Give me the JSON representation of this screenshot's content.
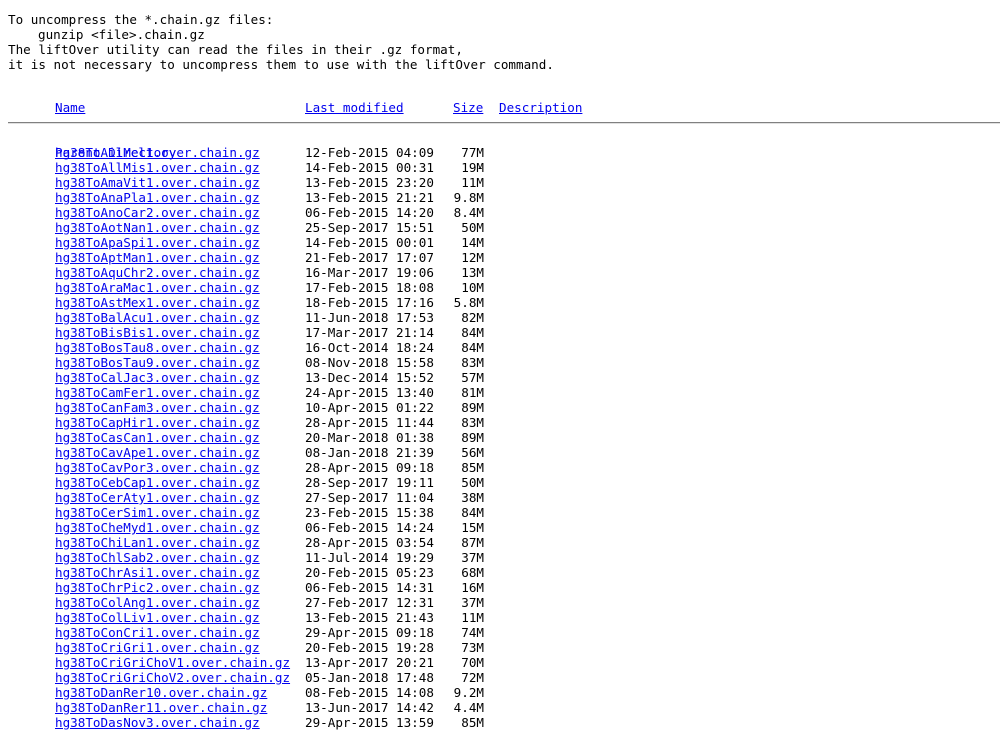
{
  "intro": {
    "line1": "To uncompress the *.chain.gz files:",
    "line2": "gunzip <file>.chain.gz",
    "line3": "The liftOver utility can read the files in their .gz format,",
    "line4": "it is not necessary to uncompress them to use with the liftOver command."
  },
  "columns": {
    "name": "Name",
    "last_modified": "Last modified",
    "size": "Size",
    "description": "Description"
  },
  "parent": {
    "label": "Parent Directory",
    "size": "-"
  },
  "files": [
    {
      "name": "hg38ToAilMel1.over.chain.gz",
      "date": "12-Feb-2015 04:09",
      "size": "77M"
    },
    {
      "name": "hg38ToAllMis1.over.chain.gz",
      "date": "14-Feb-2015 00:31",
      "size": "19M"
    },
    {
      "name": "hg38ToAmaVit1.over.chain.gz",
      "date": "13-Feb-2015 23:20",
      "size": "11M"
    },
    {
      "name": "hg38ToAnaPla1.over.chain.gz",
      "date": "13-Feb-2015 21:21",
      "size": "9.8M"
    },
    {
      "name": "hg38ToAnoCar2.over.chain.gz",
      "date": "06-Feb-2015 14:20",
      "size": "8.4M"
    },
    {
      "name": "hg38ToAotNan1.over.chain.gz",
      "date": "25-Sep-2017 15:51",
      "size": "50M"
    },
    {
      "name": "hg38ToApaSpi1.over.chain.gz",
      "date": "14-Feb-2015 00:01",
      "size": "14M"
    },
    {
      "name": "hg38ToAptMan1.over.chain.gz",
      "date": "21-Feb-2017 17:07",
      "size": "12M"
    },
    {
      "name": "hg38ToAquChr2.over.chain.gz",
      "date": "16-Mar-2017 19:06",
      "size": "13M"
    },
    {
      "name": "hg38ToAraMac1.over.chain.gz",
      "date": "17-Feb-2015 18:08",
      "size": "10M"
    },
    {
      "name": "hg38ToAstMex1.over.chain.gz",
      "date": "18-Feb-2015 17:16",
      "size": "5.8M"
    },
    {
      "name": "hg38ToBalAcu1.over.chain.gz",
      "date": "11-Jun-2018 17:53",
      "size": "82M"
    },
    {
      "name": "hg38ToBisBis1.over.chain.gz",
      "date": "17-Mar-2017 21:14",
      "size": "84M"
    },
    {
      "name": "hg38ToBosTau8.over.chain.gz",
      "date": "16-Oct-2014 18:24",
      "size": "84M"
    },
    {
      "name": "hg38ToBosTau9.over.chain.gz",
      "date": "08-Nov-2018 15:58",
      "size": "83M"
    },
    {
      "name": "hg38ToCalJac3.over.chain.gz",
      "date": "13-Dec-2014 15:52",
      "size": "57M"
    },
    {
      "name": "hg38ToCamFer1.over.chain.gz",
      "date": "24-Apr-2015 13:40",
      "size": "81M"
    },
    {
      "name": "hg38ToCanFam3.over.chain.gz",
      "date": "10-Apr-2015 01:22",
      "size": "89M"
    },
    {
      "name": "hg38ToCapHir1.over.chain.gz",
      "date": "28-Apr-2015 11:44",
      "size": "83M"
    },
    {
      "name": "hg38ToCasCan1.over.chain.gz",
      "date": "20-Mar-2018 01:38",
      "size": "89M"
    },
    {
      "name": "hg38ToCavApe1.over.chain.gz",
      "date": "08-Jan-2018 21:39",
      "size": "56M"
    },
    {
      "name": "hg38ToCavPor3.over.chain.gz",
      "date": "28-Apr-2015 09:18",
      "size": "85M"
    },
    {
      "name": "hg38ToCebCap1.over.chain.gz",
      "date": "28-Sep-2017 19:11",
      "size": "50M"
    },
    {
      "name": "hg38ToCerAty1.over.chain.gz",
      "date": "27-Sep-2017 11:04",
      "size": "38M"
    },
    {
      "name": "hg38ToCerSim1.over.chain.gz",
      "date": "23-Feb-2015 15:38",
      "size": "84M"
    },
    {
      "name": "hg38ToCheMyd1.over.chain.gz",
      "date": "06-Feb-2015 14:24",
      "size": "15M"
    },
    {
      "name": "hg38ToChiLan1.over.chain.gz",
      "date": "28-Apr-2015 03:54",
      "size": "87M"
    },
    {
      "name": "hg38ToChlSab2.over.chain.gz",
      "date": "11-Jul-2014 19:29",
      "size": "37M"
    },
    {
      "name": "hg38ToChrAsi1.over.chain.gz",
      "date": "20-Feb-2015 05:23",
      "size": "68M"
    },
    {
      "name": "hg38ToChrPic2.over.chain.gz",
      "date": "06-Feb-2015 14:31",
      "size": "16M"
    },
    {
      "name": "hg38ToColAng1.over.chain.gz",
      "date": "27-Feb-2017 12:31",
      "size": "37M"
    },
    {
      "name": "hg38ToColLiv1.over.chain.gz",
      "date": "13-Feb-2015 21:43",
      "size": "11M"
    },
    {
      "name": "hg38ToConCri1.over.chain.gz",
      "date": "29-Apr-2015 09:18",
      "size": "74M"
    },
    {
      "name": "hg38ToCriGri1.over.chain.gz",
      "date": "20-Feb-2015 19:28",
      "size": "73M"
    },
    {
      "name": "hg38ToCriGriChoV1.over.chain.gz",
      "date": "13-Apr-2017 20:21",
      "size": "70M"
    },
    {
      "name": "hg38ToCriGriChoV2.over.chain.gz",
      "date": "05-Jan-2018 17:48",
      "size": "72M"
    },
    {
      "name": "hg38ToDanRer10.over.chain.gz",
      "date": "08-Feb-2015 14:08",
      "size": "9.2M"
    },
    {
      "name": "hg38ToDanRer11.over.chain.gz",
      "date": "13-Jun-2017 14:42",
      "size": "4.4M"
    },
    {
      "name": "hg38ToDasNov3.over.chain.gz",
      "date": "29-Apr-2015 13:59",
      "size": "85M"
    }
  ]
}
